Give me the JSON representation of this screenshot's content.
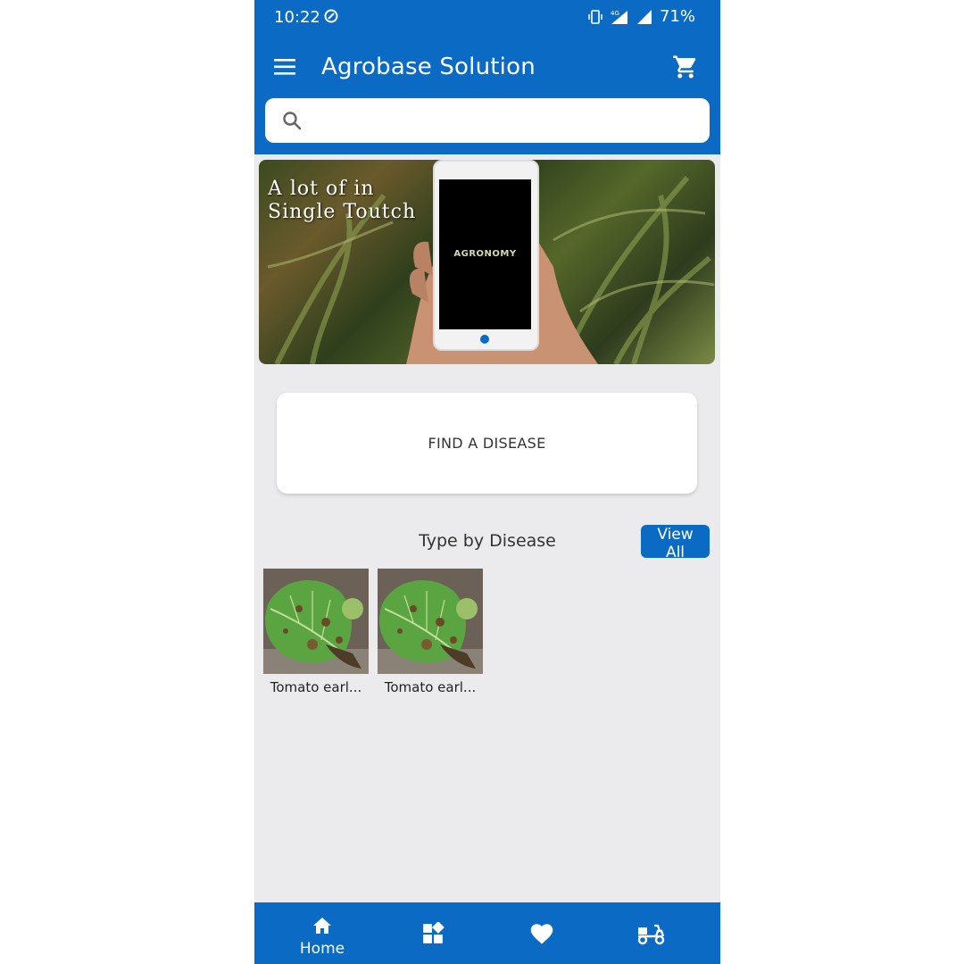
{
  "status_bar": {
    "time": "10:22",
    "network": "4G",
    "battery": "71%"
  },
  "app_bar": {
    "title": "Agrobase Solution",
    "menu_icon": "hamburger-menu-icon",
    "cart_icon": "shopping-cart-icon"
  },
  "search": {
    "placeholder": "",
    "value": "",
    "icon": "search-icon"
  },
  "banner": {
    "line1": "A lot of in",
    "line2": "Single Toutch",
    "phone_logo": "AGRONOMY"
  },
  "find_disease": {
    "label": "FIND A DISEASE"
  },
  "section": {
    "title": "Type by Disease",
    "view_all_label": "View All"
  },
  "diseases": [
    {
      "name": "Tomato earl..."
    },
    {
      "name": "Tomato earl..."
    }
  ],
  "bottom_nav": {
    "items": [
      {
        "label": "Home",
        "icon": "home-icon"
      },
      {
        "label": "",
        "icon": "categories-icon"
      },
      {
        "label": "",
        "icon": "favorite-icon"
      },
      {
        "label": "",
        "icon": "delivery-scooter-icon"
      }
    ]
  },
  "colors": {
    "primary": "#0b6bc4",
    "background": "#ebebed",
    "card": "#ffffff"
  }
}
